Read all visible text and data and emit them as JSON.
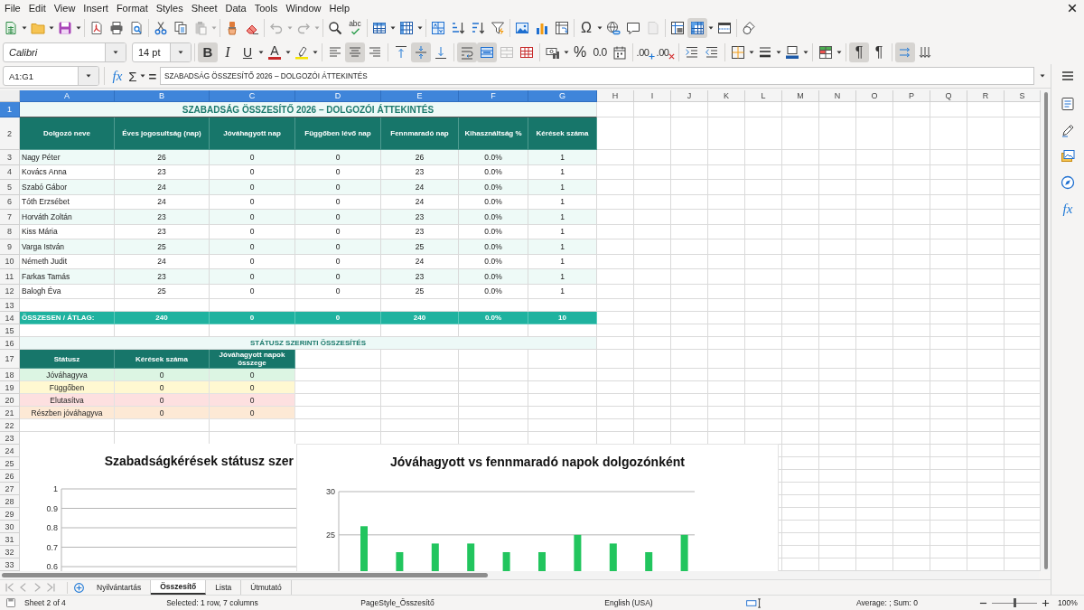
{
  "menu_bar": [
    "File",
    "Edit",
    "View",
    "Insert",
    "Format",
    "Styles",
    "Sheet",
    "Data",
    "Tools",
    "Window",
    "Help"
  ],
  "standard_toolbar": {
    "paste_disabled": true,
    "undo_disabled": true,
    "redo_disabled": true,
    "spelling_label": "abc",
    "special_character_label": "Ω",
    "headers_footers_disabled": true,
    "freeze_on": true
  },
  "format_toolbar": {
    "font_name": "Calibri",
    "font_size": "14 pt",
    "bold": {
      "label": "B",
      "on": true
    },
    "italic": {
      "label": "I",
      "on": false
    },
    "underline": {
      "label": "U",
      "on": false
    },
    "font_color_label": "A",
    "align_left_on": false,
    "align_center_on": true,
    "align_right_on": false,
    "align_top_on": false,
    "align_middle_on": true,
    "align_bottom_on": false,
    "wrap_text_on": true,
    "merge_and_center_on": true,
    "merge_cells_disabled": true,
    "percent_label": "%",
    "number_label": "0.0",
    "add_decimal_label": ".00",
    "delete_decimal_label": ".00",
    "left_to_right": {
      "label": "¶",
      "on": true
    },
    "right_to_left": {
      "label": "¶",
      "on": false
    },
    "text_left_to_right_on": true,
    "text_top_to_bottom_on": false
  },
  "formula_bar": {
    "name_box": "A1:G1",
    "function_wizard_label": "fx",
    "sum_label": "Σ",
    "formula_label": "=",
    "formula": "SZABADSÁG ÖSSZESÍTŐ 2026 – DOLGOZÓI ÁTTEKINTÉS"
  },
  "sidebar": {
    "functions_label": "fx"
  },
  "sheet": {
    "columns": [
      {
        "label": "A",
        "selected": true
      },
      {
        "label": "B",
        "selected": true
      },
      {
        "label": "C",
        "selected": true
      },
      {
        "label": "D",
        "selected": true
      },
      {
        "label": "E",
        "selected": true
      },
      {
        "label": "F",
        "selected": true
      },
      {
        "label": "G",
        "selected": true
      },
      {
        "label": "H",
        "selected": false
      },
      {
        "label": "I",
        "selected": false
      },
      {
        "label": "J",
        "selected": false
      },
      {
        "label": "K",
        "selected": false
      },
      {
        "label": "L",
        "selected": false
      },
      {
        "label": "M",
        "selected": false
      },
      {
        "label": "N",
        "selected": false
      },
      {
        "label": "O",
        "selected": false
      },
      {
        "label": "P",
        "selected": false
      },
      {
        "label": "Q",
        "selected": false
      },
      {
        "label": "R",
        "selected": false
      },
      {
        "label": "S",
        "selected": false
      }
    ],
    "rows": [
      {
        "label": "1",
        "selected": true
      },
      {
        "label": "2",
        "selected": false
      },
      {
        "label": "3",
        "selected": false
      },
      {
        "label": "4",
        "selected": false
      },
      {
        "label": "5",
        "selected": false
      },
      {
        "label": "6",
        "selected": false
      },
      {
        "label": "7",
        "selected": false
      },
      {
        "label": "8",
        "selected": false
      },
      {
        "label": "9",
        "selected": false
      },
      {
        "label": "10",
        "selected": false
      },
      {
        "label": "11",
        "selected": false
      },
      {
        "label": "12",
        "selected": false
      },
      {
        "label": "13",
        "selected": false
      },
      {
        "label": "14",
        "selected": false
      },
      {
        "label": "15",
        "selected": false
      },
      {
        "label": "16",
        "selected": false
      },
      {
        "label": "17",
        "selected": false
      },
      {
        "label": "18",
        "selected": false
      },
      {
        "label": "19",
        "selected": false
      },
      {
        "label": "20",
        "selected": false
      },
      {
        "label": "21",
        "selected": false
      },
      {
        "label": "22",
        "selected": false
      },
      {
        "label": "23",
        "selected": false
      },
      {
        "label": "24",
        "selected": false
      },
      {
        "label": "25",
        "selected": false
      },
      {
        "label": "26",
        "selected": false
      },
      {
        "label": "27",
        "selected": false
      },
      {
        "label": "28",
        "selected": false
      },
      {
        "label": "29",
        "selected": false
      },
      {
        "label": "30",
        "selected": false
      },
      {
        "label": "31",
        "selected": false
      },
      {
        "label": "32",
        "selected": false
      },
      {
        "label": "33",
        "selected": false
      }
    ]
  },
  "title": "SZABADSÁG ÖSSZESÍTŐ 2026 – DOLGOZÓI ÁTTEKINTÉS",
  "table": {
    "columns": [
      "Dolgozó neve",
      "Éves jogosultság (nap)",
      "Jóváhagyott nap",
      "Függőben lévő nap",
      "Fennmaradó nap",
      "Kihasználtság %",
      "Kérések száma"
    ],
    "rows": [
      {
        "cells": [
          "Nagy Péter",
          "26",
          "0",
          "0",
          "26",
          "0.0%",
          "1"
        ]
      },
      {
        "cells": [
          "Kovács Anna",
          "23",
          "0",
          "0",
          "23",
          "0.0%",
          "1"
        ]
      },
      {
        "cells": [
          "Szabó Gábor",
          "24",
          "0",
          "0",
          "24",
          "0.0%",
          "1"
        ]
      },
      {
        "cells": [
          "Tóth Erzsébet",
          "24",
          "0",
          "0",
          "24",
          "0.0%",
          "1"
        ]
      },
      {
        "cells": [
          "Horváth Zoltán",
          "23",
          "0",
          "0",
          "23",
          "0.0%",
          "1"
        ]
      },
      {
        "cells": [
          "Kiss Mária",
          "23",
          "0",
          "0",
          "23",
          "0.0%",
          "1"
        ]
      },
      {
        "cells": [
          "Varga István",
          "25",
          "0",
          "0",
          "25",
          "0.0%",
          "1"
        ]
      },
      {
        "cells": [
          "Németh Judit",
          "24",
          "0",
          "0",
          "24",
          "0.0%",
          "1"
        ]
      },
      {
        "cells": [
          "Farkas Tamás",
          "23",
          "0",
          "0",
          "23",
          "0.0%",
          "1"
        ]
      },
      {
        "cells": [
          "Balogh Éva",
          "25",
          "0",
          "0",
          "25",
          "0.0%",
          "1"
        ]
      }
    ],
    "total": [
      "ÖSSZESEN / ÁTLAG:",
      "240",
      "0",
      "0",
      "240",
      "0.0%",
      "10"
    ]
  },
  "status_summary": {
    "title": "STÁTUSZ SZERINTI ÖSSZESÍTÉS",
    "columns": [
      "Státusz",
      "Kérések száma",
      "Jóváhagyott napok összege"
    ],
    "rows": [
      {
        "cells": [
          "Jóváhagyva",
          "0",
          "0"
        ],
        "color": "#dcf5e3"
      },
      {
        "cells": [
          "Függőben",
          "0",
          "0"
        ],
        "color": "#fff8d1"
      },
      {
        "cells": [
          "Elutasítva",
          "0",
          "0"
        ],
        "color": "#fde0e0"
      },
      {
        "cells": [
          "Részben jóváhagyva",
          "0",
          "0"
        ],
        "color": "#fde9d5"
      }
    ]
  },
  "status_chart": {
    "title": "Szabadságkérések státusz szer",
    "axis_labels": [
      "1",
      "0.9",
      "0.8",
      "0.7",
      "0.6"
    ]
  },
  "days_chart": {
    "chart_data": {
      "type": "bar",
      "title": "Jóváhagyott vs fennmaradó napok dolgozónként",
      "ylim": [
        20.7,
        30
      ],
      "yticks": [
        25,
        30
      ],
      "series": [
        {
          "color": "#22c55e",
          "values": [
            26,
            23,
            24,
            24,
            23,
            23,
            25,
            24,
            23,
            25
          ]
        }
      ]
    }
  },
  "sheet_tabs": [
    {
      "label": "Nyilvántartás",
      "selected": false
    },
    {
      "label": "Összesítő",
      "selected": true
    },
    {
      "label": "Lista",
      "selected": false
    },
    {
      "label": "Útmutató",
      "selected": false
    }
  ],
  "status_bar": {
    "sheet": "Sheet 2 of 4",
    "selection": "Selected: 1 row, 7 columns",
    "page_style": "PageStyle_Összesítő",
    "language": "English (USA)",
    "summary": "Average: ; Sum: 0",
    "zoom_slider": {
      "level": 0.5
    },
    "zoom": "100%"
  }
}
